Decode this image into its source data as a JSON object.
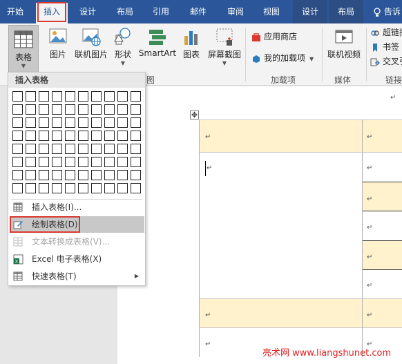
{
  "tabs": [
    {
      "label": "开始",
      "active": false
    },
    {
      "label": "插入",
      "active": true
    },
    {
      "label": "设计",
      "active": false
    },
    {
      "label": "布局",
      "active": false
    },
    {
      "label": "引用",
      "active": false
    },
    {
      "label": "邮件",
      "active": false
    },
    {
      "label": "审阅",
      "active": false
    },
    {
      "label": "视图",
      "active": false
    },
    {
      "label": "设计",
      "active": false,
      "contextual": true
    },
    {
      "label": "布局",
      "active": false,
      "contextual": true
    }
  ],
  "tell_me": "告诉",
  "ribbon": {
    "table": "表格",
    "picture": "图片",
    "online_picture": "联机图片",
    "shapes": "形状",
    "smartart": "SmartArt",
    "chart": "图表",
    "screenshot": "屏幕截图",
    "store": "应用商店",
    "my_addins": "我的加载项",
    "online_video": "联机视频",
    "hyperlink": "超链接",
    "bookmark": "书签",
    "cross_ref": "交叉引",
    "group_illustrations": "图",
    "group_addins": "加载项",
    "group_media": "媒体",
    "group_links": "链接"
  },
  "dropdown": {
    "header": "插入表格",
    "grid_cols": 10,
    "grid_rows": 8,
    "items": [
      {
        "label": "插入表格(I)...",
        "enabled": true,
        "icon": "insert-table-icon"
      },
      {
        "label": "绘制表格(D)",
        "enabled": true,
        "icon": "draw-table-icon",
        "highlighted": true
      },
      {
        "label": "文本转换成表格(V)...",
        "enabled": false,
        "icon": "text-to-table-icon"
      },
      {
        "label": "Excel 电子表格(X)",
        "enabled": true,
        "icon": "excel-icon"
      },
      {
        "label": "快速表格(T)",
        "enabled": true,
        "icon": "quick-table-icon",
        "submenu": true
      }
    ]
  },
  "document": {
    "paragraph_mark": "↵",
    "move_handle": "✥"
  },
  "watermark": "亮术网 www.liangshunet.com"
}
